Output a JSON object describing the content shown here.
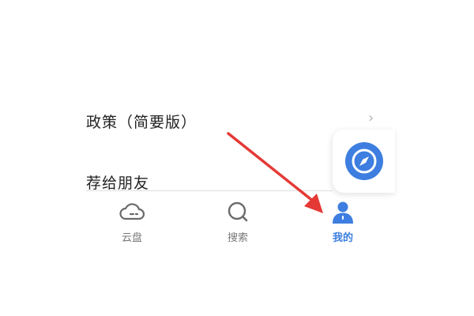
{
  "menu": {
    "items": [
      {
        "label": "政策（简要版）",
        "chevron": "›"
      },
      {
        "label": "荐给朋友"
      }
    ]
  },
  "floating_widget": {
    "icon": "compass-icon",
    "color": "#3d7ee0"
  },
  "tabbar": {
    "tabs": [
      {
        "label": "云盘",
        "icon": "cloud-icon",
        "active": false
      },
      {
        "label": "搜索",
        "icon": "search-icon",
        "active": false
      },
      {
        "label": "我的",
        "icon": "user-icon",
        "active": true
      }
    ]
  },
  "colors": {
    "accent": "#3d7ee0",
    "annotation_arrow": "#e53935",
    "inactive": "#777777"
  }
}
